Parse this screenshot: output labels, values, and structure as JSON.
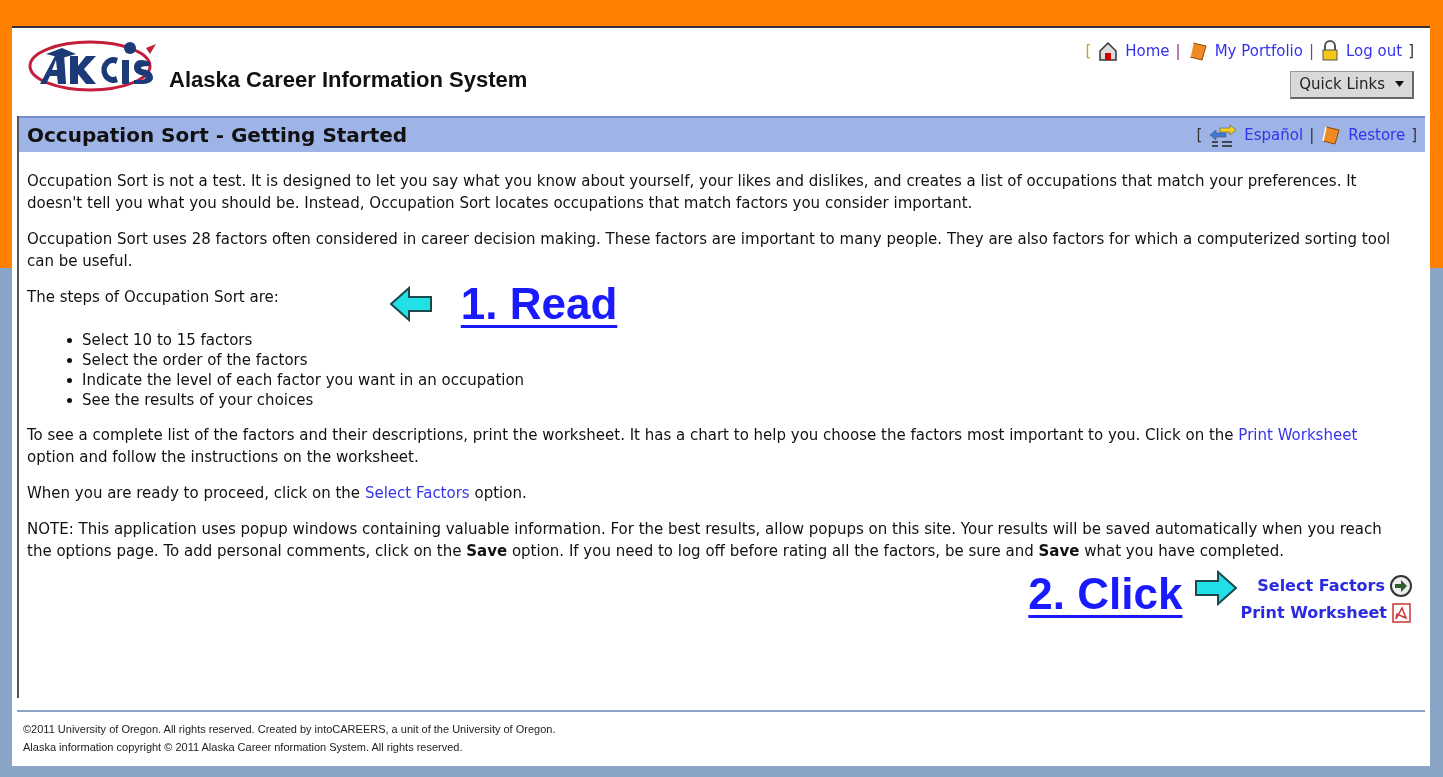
{
  "header": {
    "site_title": "Alaska Career Information System",
    "top_links": [
      {
        "kind": "home",
        "label": "Home"
      },
      {
        "kind": "portfolio",
        "label": "My Portfolio"
      },
      {
        "kind": "logout",
        "label": "Log out"
      }
    ],
    "bracket_open": "[",
    "bracket_close": "]",
    "separator": "|",
    "quick_links": "Quick Links"
  },
  "title_bar": {
    "title": "Occupation Sort - Getting Started",
    "links": [
      {
        "kind": "language",
        "label": "Español"
      },
      {
        "kind": "restore",
        "label": "Restore"
      }
    ]
  },
  "intro": [
    "Occupation Sort is not a test. It is designed to let you say what you know about yourself, your likes and dislikes, and creates a list of occupations that match your preferences. It doesn't tell you what you should be. Instead, Occupation Sort locates occupations that match factors you consider important.",
    "Occupation Sort uses 28 factors often considered in career decision making. These factors are important to many people. They are also factors for which a computerized sorting tool can be useful."
  ],
  "steps_heading": "The steps of Occupation Sort are:",
  "read_annotation": "1. Read",
  "steps": [
    "Select 10 to 15 factors",
    "Select the order of the factors",
    "Indicate the level of each factor you want in an occupation",
    "See the results of your choices"
  ],
  "worksheet_paragraph": {
    "before": "To see a complete list of the factors and their descriptions, print the worksheet. It has a chart to help you choose the factors most important to you. Click on the",
    "link": "Print Worksheet",
    "after": "option and follow the instructions on the worksheet."
  },
  "proceed_paragraph": {
    "before": "When you are ready to proceed, click on the",
    "link": "Select Factors",
    "after": "option."
  },
  "note": "NOTE: This application uses popup windows containing valuable information. For the best results, allow popups on this site. Your results will be saved automatically when you reach the options page. To add personal comments, click on the **Save** option. If you need to log off before rating all the factors, be sure and **Save** what you have completed.",
  "click_annotation": "2. Click",
  "actions": [
    {
      "kind": "next",
      "label": "Select Factors"
    },
    {
      "kind": "pdf",
      "label": "Print Worksheet"
    }
  ],
  "footer": [
    "©2011 University of Oregon. All rights reserved. Created by intoCAREERS, a unit of the University of Oregon.",
    "Alaska information copyright © 2011 Alaska Career nformation System. All rights reserved."
  ]
}
